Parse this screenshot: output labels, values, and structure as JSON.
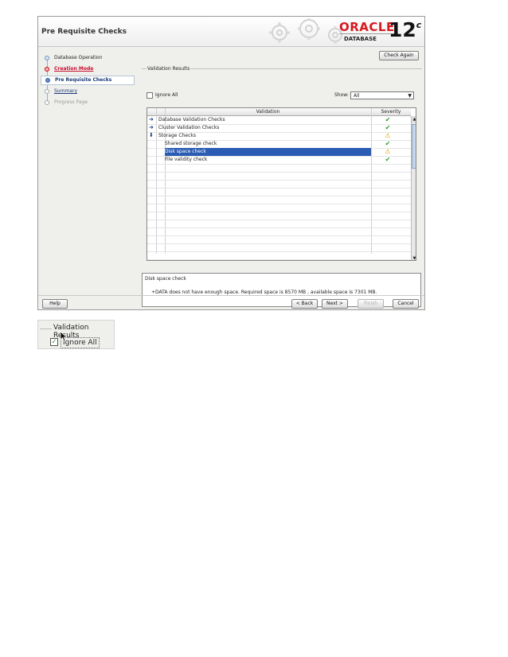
{
  "window": {
    "page_title": "Pre Requisite Checks",
    "brand": "ORACLE",
    "brand_sub": "DATABASE",
    "version": "12",
    "version_suffix": "c"
  },
  "nav": {
    "items": [
      {
        "label": "Database Operation",
        "state": "done"
      },
      {
        "label": "Creation Mode",
        "state": "error"
      },
      {
        "label": "Pre Requisite Checks",
        "state": "current"
      },
      {
        "label": "Summary",
        "state": "link"
      },
      {
        "label": "Progress Page",
        "state": "future"
      }
    ]
  },
  "main": {
    "check_again": "Check Again",
    "group_title": "Validation Results",
    "ignore_all": "Ignore All",
    "ignore_all_checked": false,
    "show_label": "Show:",
    "show_value": "All",
    "table": {
      "col_validation": "Validation",
      "col_severity": "Severity",
      "rows": [
        {
          "label": "Database Validation Checks",
          "indent": 0,
          "arrow": "right",
          "severity": "ok",
          "selected": false
        },
        {
          "label": "Cluster Validation Checks",
          "indent": 0,
          "arrow": "right",
          "severity": "ok",
          "selected": false
        },
        {
          "label": "Storage Checks",
          "indent": 0,
          "arrow": "down",
          "severity": "warning",
          "selected": false
        },
        {
          "label": "Shared storage check",
          "indent": 1,
          "arrow": "",
          "severity": "ok",
          "selected": false
        },
        {
          "label": "Disk space check",
          "indent": 1,
          "arrow": "",
          "severity": "warning",
          "selected": true
        },
        {
          "label": "File validity check",
          "indent": 1,
          "arrow": "",
          "severity": "ok",
          "selected": false
        }
      ]
    },
    "details": {
      "title": "Disk space check",
      "message": "+DATA does not have enough space. Required space is 8570 MB , available space is 7301 MB."
    }
  },
  "footer": {
    "help": "Help",
    "back": "< Back",
    "next": "Next >",
    "finish": "Finish",
    "cancel": "Cancel"
  },
  "zoom": {
    "group_title": "Validation Results",
    "ignore_all": "Ignore All",
    "ignore_all_checked": true
  }
}
